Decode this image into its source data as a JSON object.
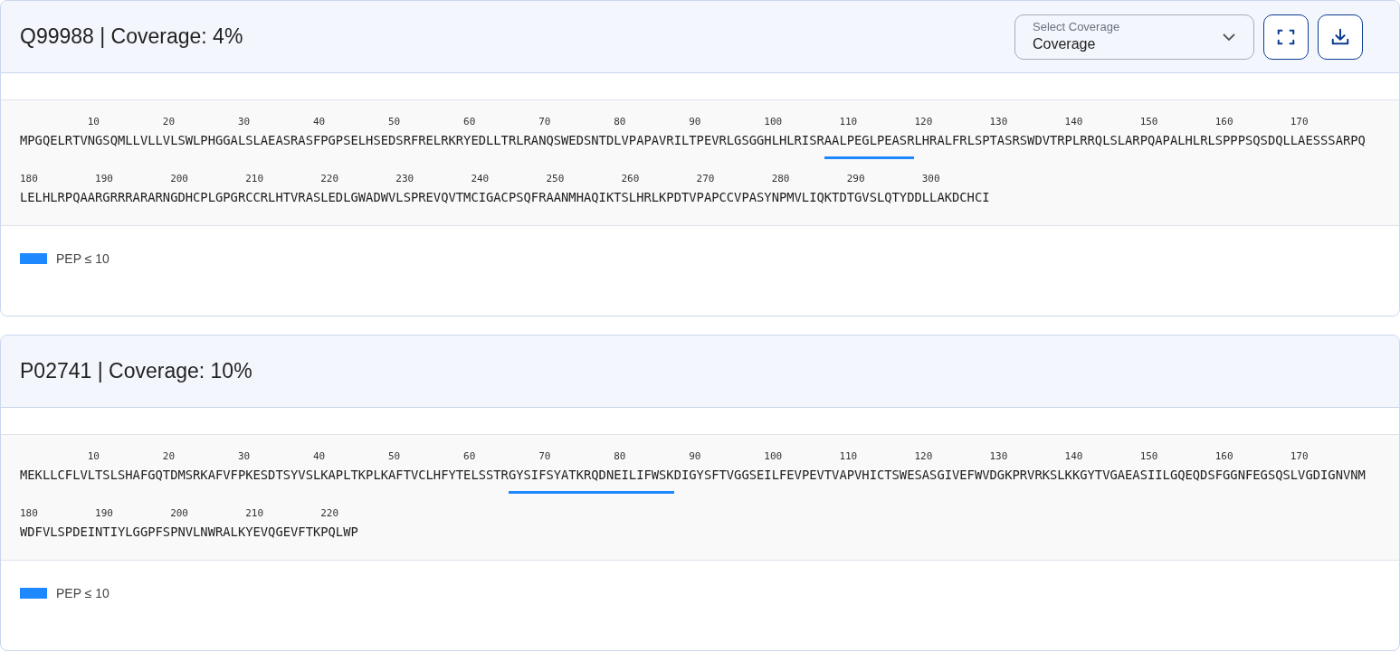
{
  "proteins": [
    {
      "title": "Q99988 | Coverage: 4%",
      "controls": {
        "select": {
          "label": "Select Coverage",
          "value": "Coverage"
        },
        "buttons": [
          {
            "kind": "fullscreen"
          },
          {
            "kind": "download"
          }
        ]
      },
      "lines": [
        {
          "ticks": [
            "10",
            "20",
            "30",
            "40",
            "50",
            "60",
            "70",
            "80",
            "90",
            "100",
            "110",
            "120",
            "130",
            "140",
            "150",
            "160",
            "170"
          ],
          "segments": [
            {
              "text": "MPGQELRTVNGSQMLLVLLVLSWLPHGGALSLAEASRASFPGPSELHSEDSRFRELRKRYEDLLTRLRANQSWEDSNTDLVPAPAVRILTPEVRLGSGGHLHLRISR",
              "covered": false
            },
            {
              "text": "AALPEGLPEASR",
              "covered": true
            },
            {
              "text": "LHRALFRLSPTASRSWDVTRPLRRQLSLARPQAPALHLRLSPPPSQSDQLLAESSSARPQ",
              "covered": false
            }
          ]
        },
        {
          "ticks": [
            "180",
            "190",
            "200",
            "210",
            "220",
            "230",
            "240",
            "250",
            "260",
            "270",
            "280",
            "290",
            "300"
          ],
          "segments": [
            {
              "text": "LELHLRPQAARGRRRARARNGDHCPLGPGRCCRLHTVRASLEDLGWADWVLSPREVQVTMCIGACPSQFRAANMHAQIKTSLHRLKPDTVPAPCCVPASYNPMVLIQKTDTGVSLQTYDDLLAKDCHCI",
              "covered": false
            }
          ]
        }
      ],
      "legend": [
        {
          "label": "PEP ≤ 10",
          "color": "#1e88ff"
        }
      ]
    },
    {
      "title": "P02741 | Coverage: 10%",
      "lines": [
        {
          "ticks": [
            "10",
            "20",
            "30",
            "40",
            "50",
            "60",
            "70",
            "80",
            "90",
            "100",
            "110",
            "120",
            "130",
            "140",
            "150",
            "160",
            "170"
          ],
          "segments": [
            {
              "text": "MEKLLCFLVLTSLSHAFGQTDMSRKAFVFPKESDTSYVSLKAPLTKPLKAFTVCLHFYTELSSTR",
              "covered": false
            },
            {
              "text": "GYSIFSYATKRQDNEILIFWSK",
              "covered": true
            },
            {
              "text": "DIGYSFTVGGSEILFEVPEVTVAPVHICTSWESASGIVEFWVDGKPRVRKSLKKGYTVGAEASIILGQEQDSFGGNFEGSQSLVGDIGNVNM",
              "covered": false
            }
          ]
        },
        {
          "ticks": [
            "180",
            "190",
            "200",
            "210",
            "220"
          ],
          "segments": [
            {
              "text": "WDFVLSPDEINTIYLGGPFSPNVLNWRALKYEVQGEVFTKPQLWP",
              "covered": false
            }
          ]
        }
      ],
      "legend": [
        {
          "label": "PEP ≤ 10",
          "color": "#1e88ff"
        }
      ]
    }
  ]
}
